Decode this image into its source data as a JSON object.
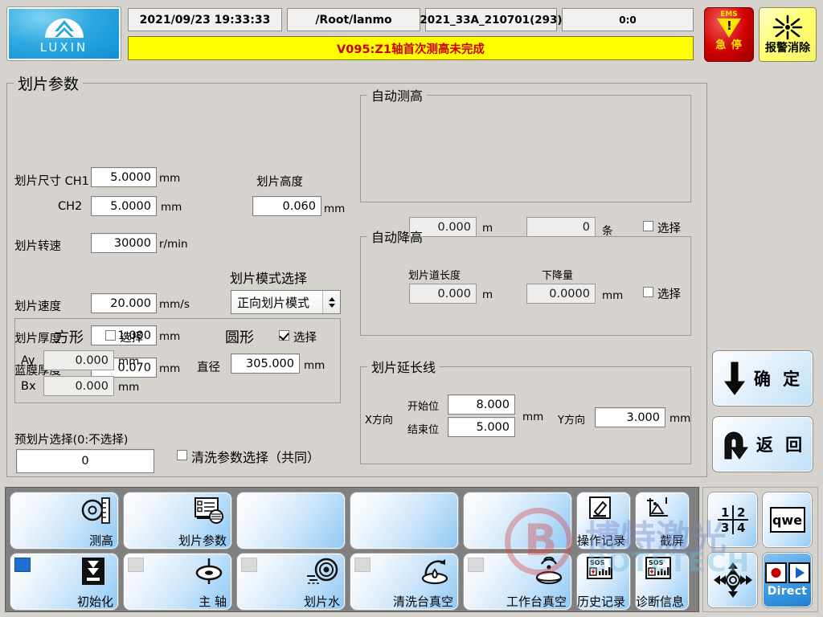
{
  "header": {
    "logo_text": "LUXIN",
    "datetime": "2021/09/23 19:33:33",
    "path": "/Root/lanmo",
    "recipe": "2021_33A_210701(293)",
    "counter": "0:0",
    "alarm_message": "V095:Z1轴首次测高未完成",
    "ems_top": "EMS",
    "ems_label": "急 停",
    "alarm_clear_label": "报警消除",
    "alarm_bg": "#ffff00",
    "alarm_color": "#cc0000",
    "ems_color": "#d00000"
  },
  "panel": {
    "title": "划片参数",
    "size_label": "划片尺寸 CH1",
    "size_ch1": "5.0000",
    "size_ch1_unit": "mm",
    "ch2_label": "CH2",
    "size_ch2": "5.0000",
    "size_ch2_unit": "mm",
    "speed_rpm_label": "划片转速",
    "speed_rpm": "30000",
    "speed_rpm_unit": "r/min",
    "feed_label": "划片速度",
    "feed": "20.000",
    "feed_unit": "mm/s",
    "thickness_label": "划片厚度",
    "thickness": "1.000",
    "thickness_unit": "mm",
    "film_label": "蓝膜厚度",
    "film": "0.070",
    "film_unit": "mm",
    "height_label": "划片高度",
    "height": "0.060",
    "height_unit": "mm",
    "mode_label": "划片模式选择",
    "mode_value": "正向划片模式"
  },
  "shape": {
    "square_label": "方形",
    "square_select_label": "选择",
    "square_checked": false,
    "ay_label": "Ay",
    "ay": "0.000",
    "ay_unit": "mm",
    "bx_label": "Bx",
    "bx": "0.000",
    "bx_unit": "mm",
    "circle_label": "圆形",
    "circle_select_label": "选择",
    "circle_checked": true,
    "diameter_label": "直径",
    "diameter": "305.000",
    "diameter_unit": "mm"
  },
  "pre_cut": {
    "label": "预划片选择(0:不选择)",
    "value": "0",
    "clean_param_label": "清洗参数选择（共同）",
    "clean_param_checked": false
  },
  "auto_height": {
    "title": "自动测高",
    "length": "0.000",
    "length_unit": "m",
    "count": "0",
    "count_unit": "条",
    "select_label": "选择",
    "checked": false
  },
  "auto_down": {
    "title": "自动降高",
    "lane_len_label": "划片道长度",
    "lane_len": "0.000",
    "lane_len_unit": "m",
    "drop_label": "下降量",
    "drop": "0.0000",
    "drop_unit": "mm",
    "select_label": "选择",
    "checked": false
  },
  "extension": {
    "title": "划片延长线",
    "x_dir_label": "X方向",
    "start_label": "开始位",
    "start": "8.000",
    "end_label": "结束位",
    "end": "5.000",
    "x_unit": "mm",
    "y_dir_label": "Y方向",
    "y": "3.000",
    "y_unit": "mm"
  },
  "actions": {
    "confirm_label": "确 定",
    "back_label": "返 回"
  },
  "toolbar": {
    "row1": [
      {
        "label": "测高",
        "icon": "height-gauge-icon",
        "blank": false
      },
      {
        "label": "划片参数",
        "icon": "parameter-list-icon",
        "blank": false
      },
      {
        "label": "",
        "icon": "",
        "blank": true
      },
      {
        "label": "",
        "icon": "",
        "blank": true
      },
      {
        "label": "",
        "icon": "",
        "blank": true
      },
      {
        "label": "操作记录",
        "icon": "pencil-edit-icon",
        "blank": false
      },
      {
        "label": "截屏",
        "icon": "screenshot-icon",
        "blank": false
      }
    ],
    "row2": [
      {
        "label": "初始化",
        "icon": "init-download-icon",
        "indicator": "on"
      },
      {
        "label": "主 轴",
        "icon": "spindle-icon",
        "indicator": "off"
      },
      {
        "label": "划片水",
        "icon": "water-icon",
        "indicator": "off"
      },
      {
        "label": "清洗台真空",
        "icon": "clean-vacuum-icon",
        "indicator": "off"
      },
      {
        "label": "工作台真空",
        "icon": "table-vacuum-icon",
        "indicator": "off"
      },
      {
        "label": "历史记录",
        "icon": "sos-history-icon",
        "indicator": "none"
      },
      {
        "label": "诊断信息",
        "icon": "sos-diagnostic-icon",
        "indicator": "none"
      }
    ]
  },
  "right_buttons": {
    "quad": [
      "1",
      "2",
      "3",
      "4"
    ],
    "keyboard_label": "qwe",
    "jog_icon": "jog-pad-icon",
    "direct_label": "Direct"
  },
  "watermark": {
    "cn": "博特激光",
    "en": "BOTETECH"
  }
}
